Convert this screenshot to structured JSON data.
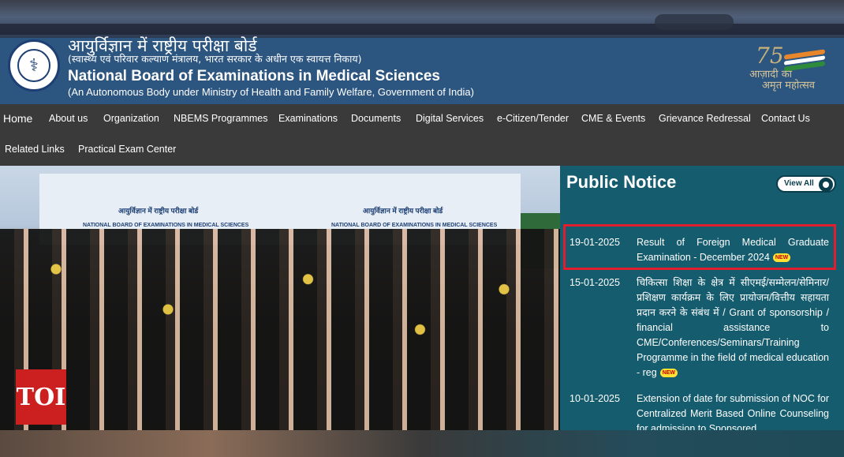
{
  "header": {
    "hindi_title": "आयुर्विज्ञान में राष्ट्रीय परीक्षा बोर्ड",
    "hindi_subtitle": "(स्वास्थ्य एवं परिवार कल्याण मंत्रालय, भारत सरकार के अधीन एक स्वायत्त निकाय)",
    "english_title": "National Board of Examinations in Medical Sciences",
    "english_subtitle": "(An Autonomous Body under Ministry of Health and Family Welfare, Government of India)",
    "azadi_number": "75",
    "azadi_line1": "आज़ादी का",
    "azadi_line2": "अमृत महोत्सव"
  },
  "nav": {
    "items": [
      "Home",
      "About us",
      "Organization",
      "NBEMS Programmes",
      "Examinations",
      "Documents",
      "Digital Services",
      "e-Citizen/Tender",
      "CME & Events",
      "Grievance Redressal",
      "Contact Us",
      "Related Links",
      "Practical Exam Center"
    ]
  },
  "photo": {
    "banner_hindi": "आयुर्विज्ञान में राष्ट्रीय परीक्षा बोर्ड",
    "banner_english": "NATIONAL BOARD OF EXAMINATIONS IN MEDICAL SCIENCES",
    "watermark": "TOI"
  },
  "notice": {
    "title": "Public Notice",
    "view_all": "View All",
    "new_badge": "NEW",
    "items": [
      {
        "date": "19-01-2025",
        "text": "Result of Foreign Medical Graduate Examination - December 2024"
      },
      {
        "date": "15-01-2025",
        "text": "चिकित्सा शिक्षा के क्षेत्र में सीएमई/सम्मेलन/सेमिनार/प्रशिक्षण कार्यक्रम के लिए प्रायोजन/वित्तीय सहायता प्रदान करने के संबंध में / Grant of sponsorship / financial assistance to CME/Conferences/Seminars/Training Programme in the field of medical education - reg"
      },
      {
        "date": "10-01-2025",
        "text": "Extension of date for submission of NOC for Centralized Merit Based Online Counseling for admission to Sponsored"
      }
    ]
  },
  "colors": {
    "header_blue": "#2c5580",
    "nav_dark": "#3a3a3a",
    "notice_teal": "#155c6e",
    "highlight_red": "#e01e2d",
    "toi_red": "#cc1f1f"
  }
}
